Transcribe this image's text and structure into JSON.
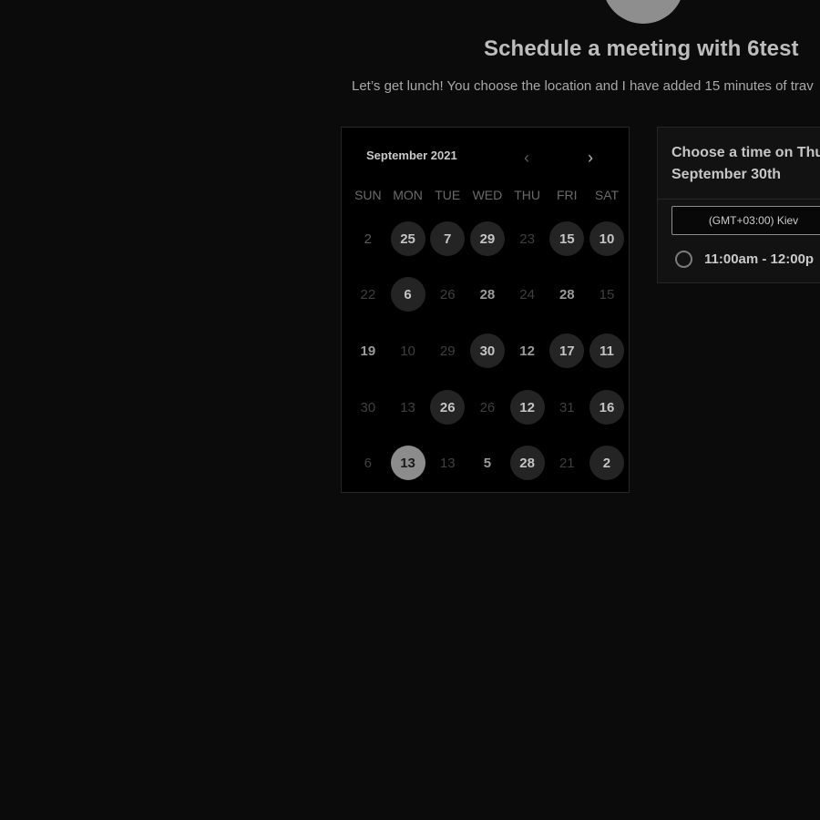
{
  "header": {
    "title": "Schedule a meeting with 6test",
    "subtitle": "Let’s get lunch! You choose the location and I have added 15 minutes of trav"
  },
  "calendar": {
    "month_label": "September 2021",
    "weekdays": [
      "SUN",
      "MON",
      "TUE",
      "WED",
      "THU",
      "FRI",
      "SAT"
    ],
    "weeks": [
      [
        {
          "day": "2",
          "state": "inactive"
        },
        {
          "day": "25",
          "state": "available"
        },
        {
          "day": "7",
          "state": "available"
        },
        {
          "day": "29",
          "state": "available"
        },
        {
          "day": "23",
          "state": "dim"
        },
        {
          "day": "15",
          "state": "available"
        },
        {
          "day": "10",
          "state": "available"
        }
      ],
      [
        {
          "day": "22",
          "state": "dim"
        },
        {
          "day": "6",
          "state": "available"
        },
        {
          "day": "26",
          "state": "dim"
        },
        {
          "day": "28",
          "state": "plain"
        },
        {
          "day": "24",
          "state": "dim"
        },
        {
          "day": "28",
          "state": "plain"
        },
        {
          "day": "15",
          "state": "dim"
        }
      ],
      [
        {
          "day": "19",
          "state": "plain"
        },
        {
          "day": "10",
          "state": "dim"
        },
        {
          "day": "29",
          "state": "dim"
        },
        {
          "day": "30",
          "state": "available"
        },
        {
          "day": "12",
          "state": "plain"
        },
        {
          "day": "17",
          "state": "available"
        },
        {
          "day": "11",
          "state": "available"
        }
      ],
      [
        {
          "day": "30",
          "state": "dim"
        },
        {
          "day": "13",
          "state": "dim"
        },
        {
          "day": "26",
          "state": "available"
        },
        {
          "day": "26",
          "state": "dim"
        },
        {
          "day": "12",
          "state": "available"
        },
        {
          "day": "31",
          "state": "dim"
        },
        {
          "day": "16",
          "state": "available"
        }
      ],
      [
        {
          "day": "6",
          "state": "dim"
        },
        {
          "day": "13",
          "state": "selected"
        },
        {
          "day": "13",
          "state": "dim"
        },
        {
          "day": "5",
          "state": "plain"
        },
        {
          "day": "28",
          "state": "available"
        },
        {
          "day": "21",
          "state": "dim"
        },
        {
          "day": "2",
          "state": "available"
        }
      ]
    ]
  },
  "time_panel": {
    "header": "Choose a time on Thu September 30th",
    "timezone": "(GMT+03:00) Kiev",
    "slot": "11:00am - 12:00p"
  },
  "colors": {
    "background": "#0b0b0b",
    "available_day": "#242424",
    "selected_day": "#8c8c8c"
  }
}
